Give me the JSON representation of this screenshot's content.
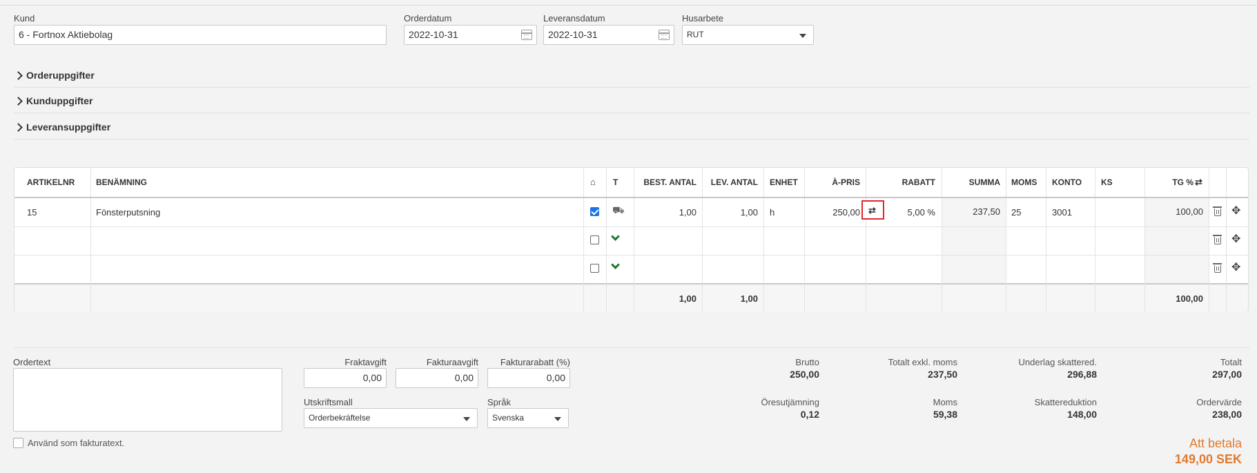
{
  "header": {
    "kund_label": "Kund",
    "kund_value": "6 - Fortnox Aktiebolag",
    "orderdatum_label": "Orderdatum",
    "orderdatum_value": "2022-10-31",
    "leveransdatum_label": "Leveransdatum",
    "leveransdatum_value": "2022-10-31",
    "husarbete_label": "Husarbete",
    "husarbete_value": "RUT"
  },
  "sections": [
    "Orderuppgifter",
    "Kunduppgifter",
    "Leveransuppgifter"
  ],
  "table": {
    "headers": {
      "artikelnr": "ARTIKELNR",
      "benamning": "BENÄMNING",
      "t": "T",
      "best_antal": "BEST. ANTAL",
      "lev_antal": "LEV. ANTAL",
      "enhet": "ENHET",
      "a_pris": "À-PRIS",
      "rabatt": "RABATT",
      "summa": "SUMMA",
      "moms": "MOMS",
      "konto": "KONTO",
      "ks": "KS",
      "tg": "TG %"
    },
    "rows": [
      {
        "artikelnr": "15",
        "benamning": "Fönsterputsning",
        "checked": true,
        "best_antal": "1,00",
        "lev_antal": "1,00",
        "enhet": "h",
        "a_pris": "250,00",
        "rabatt": "5,00 %",
        "summa": "237,50",
        "moms": "25",
        "konto": "3001",
        "tg": "100,00"
      }
    ],
    "totals": {
      "best_antal": "1,00",
      "lev_antal": "1,00",
      "tg": "100,00"
    }
  },
  "footer": {
    "ordertext_label": "Ordertext",
    "use_as_invoice_text": "Använd som fakturatext.",
    "fraktavgift_label": "Fraktavgift",
    "fraktavgift_value": "0,00",
    "fakturaavgift_label": "Fakturaavgift",
    "fakturaavgift_value": "0,00",
    "fakturarabatt_label": "Fakturarabatt (%)",
    "fakturarabatt_value": "0,00",
    "utskriftsmall_label": "Utskriftsmall",
    "utskriftsmall_value": "Orderbekräftelse",
    "sprak_label": "Språk",
    "sprak_value": "Svenska"
  },
  "totals": {
    "brutto_label": "Brutto",
    "brutto_value": "250,00",
    "exkl_moms_label": "Totalt exkl. moms",
    "exkl_moms_value": "237,50",
    "underlag_label": "Underlag skattered.",
    "underlag_value": "296,88",
    "totalt_label": "Totalt",
    "totalt_value": "297,00",
    "oresutjamning_label": "Öresutjämning",
    "oresutjamning_value": "0,12",
    "moms_label": "Moms",
    "moms_value": "59,38",
    "skattereduktion_label": "Skattereduktion",
    "skattereduktion_value": "148,00",
    "ordervarde_label": "Ordervärde",
    "ordervarde_value": "238,00",
    "att_betala_label": "Att betala",
    "att_betala_value": "149,00 SEK"
  },
  "colors": {
    "accent_orange": "#e07a2e",
    "check_blue": "#1a73e8",
    "chevron_green": "#1d7a2e",
    "highlight_red": "#e0262b"
  }
}
